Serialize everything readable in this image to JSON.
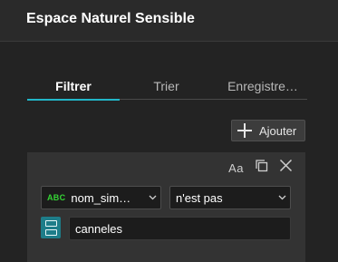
{
  "header": {
    "title": "Espace Naturel Sensible"
  },
  "tabs": [
    {
      "label": "Filtrer",
      "active": true
    },
    {
      "label": "Trier",
      "active": false
    },
    {
      "label": "Enregistre…",
      "active": false
    }
  ],
  "toolbar": {
    "add_label": "Ajouter"
  },
  "filter": {
    "case_sensitive_icon": "Aa",
    "field": {
      "type_icon": "ABC",
      "value": "nom_sim…"
    },
    "operator": {
      "value": "n'est pas"
    },
    "value": "canneles"
  },
  "colors": {
    "accent": "#22b6c8",
    "value_type_button": "#1e7d89",
    "string_icon": "#35d635"
  }
}
